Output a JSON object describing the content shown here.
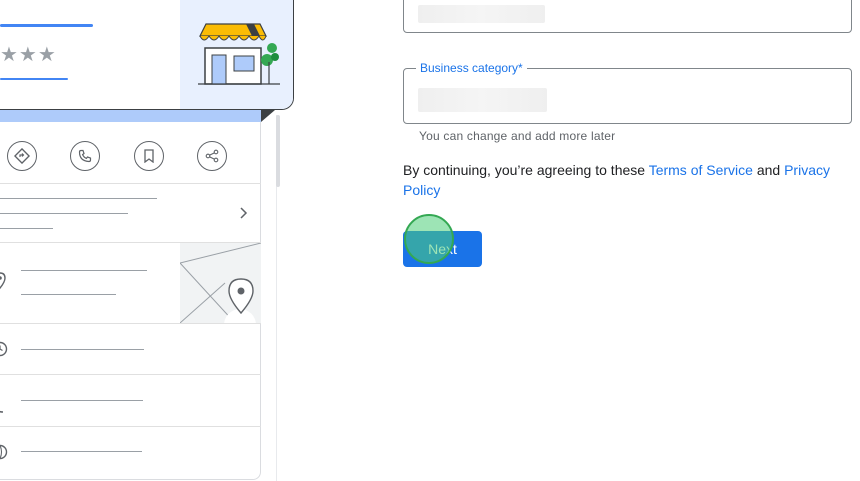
{
  "form": {
    "business_category": {
      "label": "Business category*",
      "value": ""
    },
    "helper_text": "You can change and add more later",
    "consent": {
      "prefix": "By continuing, you’re agreeing to these ",
      "terms_link": "Terms of Service",
      "middle": " and ",
      "privacy_link": "Privacy Policy"
    },
    "next_button": "Next"
  },
  "illustration": {
    "rating_stars": "★★★",
    "icons": [
      "directions-icon",
      "phone-icon",
      "bookmark-icon",
      "share-icon",
      "chevron-right-icon",
      "location-pin-icon",
      "map-pin-icon",
      "clock-icon",
      "phone-small-icon",
      "globe-icon"
    ]
  },
  "colors": {
    "accent": "#1a73e8",
    "click_indicator": "#34a853",
    "awning": "#fbbc04"
  }
}
